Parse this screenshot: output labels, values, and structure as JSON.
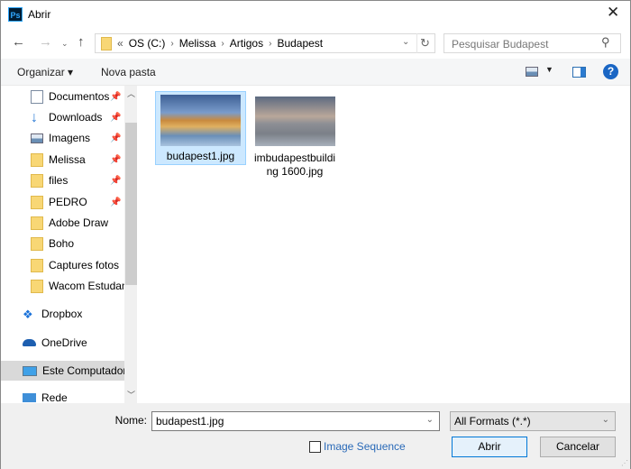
{
  "window": {
    "title": "Abrir",
    "app_icon": "Ps"
  },
  "address": {
    "overflow": "«",
    "crumbs": [
      "OS (C:)",
      "Melissa",
      "Artigos",
      "Budapest"
    ]
  },
  "search": {
    "placeholder": "Pesquisar Budapest"
  },
  "toolbar": {
    "organize": "Organizar ▾",
    "new_folder": "Nova pasta"
  },
  "nav": {
    "quick": [
      {
        "label": "Documentos",
        "icon": "document-icon",
        "pinned": true
      },
      {
        "label": "Downloads",
        "icon": "download-icon",
        "pinned": true
      },
      {
        "label": "Imagens",
        "icon": "pictures-icon",
        "pinned": true
      },
      {
        "label": "Melissa",
        "icon": "folder-icon",
        "pinned": true
      },
      {
        "label": "files",
        "icon": "folder-icon",
        "pinned": true
      },
      {
        "label": "PEDRO",
        "icon": "folder-icon",
        "pinned": true
      },
      {
        "label": "Adobe Draw",
        "icon": "folder-icon",
        "pinned": false
      },
      {
        "label": "Boho",
        "icon": "folder-icon",
        "pinned": false
      },
      {
        "label": "Captures fotos",
        "icon": "folder-icon",
        "pinned": false
      },
      {
        "label": "Wacom Estudan",
        "icon": "folder-icon",
        "pinned": false
      }
    ],
    "dropbox": "Dropbox",
    "onedrive": "OneDrive",
    "computer": "Este Computador",
    "network": "Rede"
  },
  "files": [
    {
      "name": "budapest1.jpg",
      "selected": true
    },
    {
      "name_line1": "imbudapestbuildi",
      "name_line2": "ng 1600.jpg",
      "selected": false
    }
  ],
  "bottom": {
    "name_label": "Nome:",
    "name_value": "budapest1.jpg",
    "filter": "All Formats (*.*)",
    "image_sequence": "Image Sequence",
    "image_sequence_checked": false,
    "open": "Abrir",
    "cancel": "Cancelar"
  },
  "colors": {
    "accent": "#0078d7",
    "selection": "#cce8ff",
    "link": "#0066cc"
  }
}
